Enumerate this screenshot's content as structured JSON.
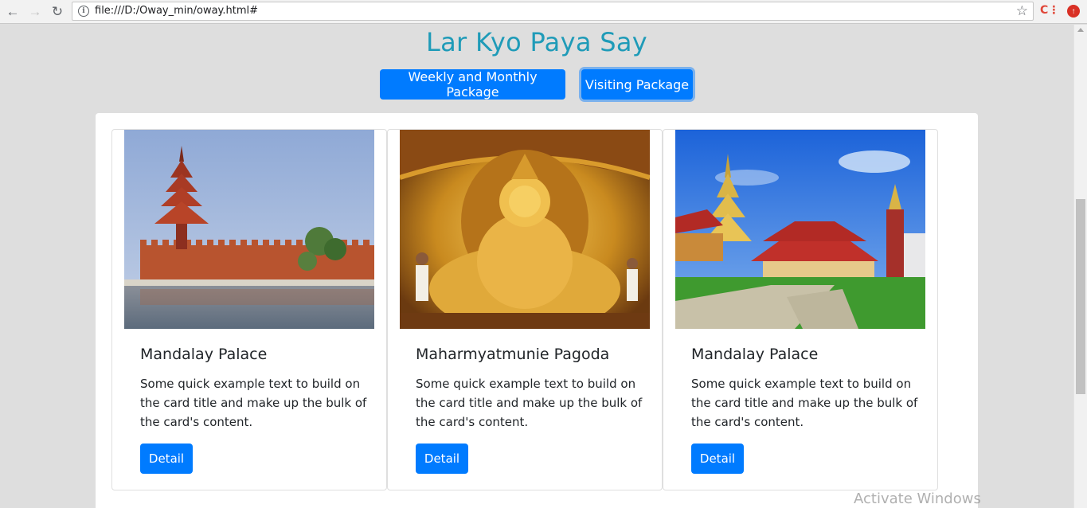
{
  "browser": {
    "url": "file:///D:/Oway_min/oway.html#",
    "back_icon": "arrow-left-icon",
    "forward_icon": "arrow-right-icon",
    "reload_icon": "reload-icon",
    "star_icon": "star-icon",
    "ext1_label": "C",
    "ext2_label": "↑"
  },
  "page": {
    "title": "Lar Kyo Paya Say",
    "title_color": "#1f9bb8",
    "accent_color": "#007bff",
    "packages": [
      {
        "label": "Weekly and Monthly Package",
        "active": false
      },
      {
        "label": "Visiting Package",
        "active": true
      }
    ]
  },
  "cards": [
    {
      "title": "Mandalay Palace",
      "text": "Some quick example text to build on the card title and make up the bulk of the card's content.",
      "button": "Detail"
    },
    {
      "title": "Maharmyatmunie Pagoda",
      "text": "Some quick example text to build on the card title and make up the bulk of the card's content.",
      "button": "Detail"
    },
    {
      "title": "Mandalay Palace",
      "text": "Some quick example text to build on the card title and make up the bulk of the card's content.",
      "button": "Detail"
    }
  ],
  "watermark": "Activate Windows"
}
